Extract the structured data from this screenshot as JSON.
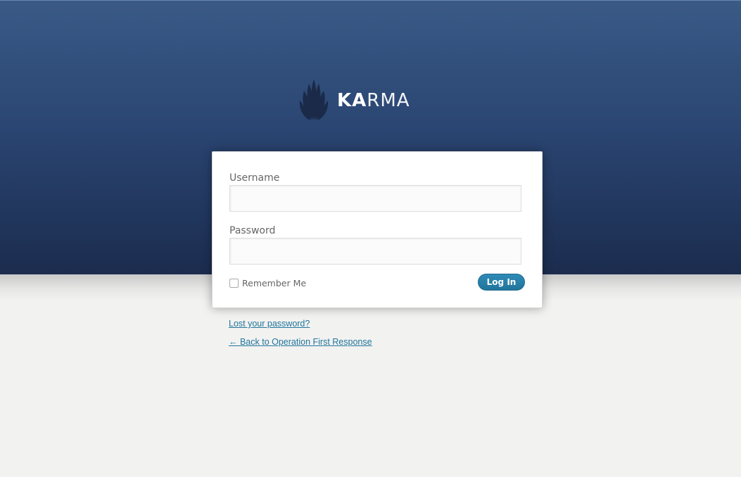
{
  "brand": {
    "logo_icon": "leaf-fan-icon",
    "name_bold": "KA",
    "name_light": "RMA"
  },
  "form": {
    "username_label": "Username",
    "username_value": "",
    "password_label": "Password",
    "password_value": "",
    "remember_label": "Remember Me",
    "remember_checked": false,
    "submit_label": "Log In"
  },
  "links": {
    "lost_password": "Lost your password?",
    "back_to_site": "← Back to Operation First Response"
  },
  "colors": {
    "header_top": "#3a5a86",
    "header_bottom": "#1b2c4e",
    "page_background": "#f2f2f1",
    "button": "#21759b",
    "link": "#21759b"
  }
}
